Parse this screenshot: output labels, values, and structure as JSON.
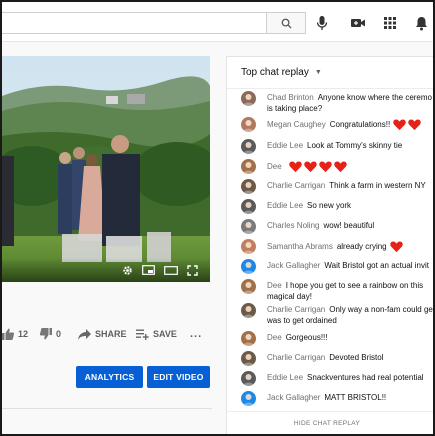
{
  "actions": {
    "likes": "12",
    "dislikes": "0",
    "share_label": "SHARE",
    "save_label": "SAVE",
    "more_label": "..."
  },
  "buttons": {
    "analytics": "ANALYTICS",
    "edit_video": "EDIT VIDEO"
  },
  "chat": {
    "header": "Top chat replay",
    "hide_label": "HIDE CHAT REPLAY",
    "messages": [
      {
        "author": "Chad Brinton",
        "text": "Anyone know where the ceremo",
        "text2": "is taking place?"
      },
      {
        "author": "Megan Caughey",
        "text": "Congratulations!!",
        "hearts": 2
      },
      {
        "author": "Eddie Lee",
        "text": "Look at Tommy's skinny tie"
      },
      {
        "author": "Dee",
        "text": "",
        "hearts": 4
      },
      {
        "author": "Charlie Carrigan",
        "text": "Think a farm in western NY"
      },
      {
        "author": "Eddie Lee",
        "text": "So new york"
      },
      {
        "author": "Charles Noling",
        "text": "wow! beautiful"
      },
      {
        "author": "Samantha Abrams",
        "text": "already crying",
        "hearts": 1
      },
      {
        "author": "Jack Gallagher",
        "text": "Wait Bristol got an actual invit"
      },
      {
        "author": "Dee",
        "text": "I hope you get to see a rainbow on this",
        "text2": "magical day!"
      },
      {
        "author": "Charlie Carrigan",
        "text": "Only way a non-fam could ge",
        "text2": "was to get ordained"
      },
      {
        "author": "Dee",
        "text": "Gorgeous!!!"
      },
      {
        "author": "Charlie Carrigan",
        "text": "Devoted Bristol"
      },
      {
        "author": "Eddie Lee",
        "text": "Snackventures had real potential"
      },
      {
        "author": "Jack Gallagher",
        "text": "MATT BRISTOL!!"
      }
    ]
  },
  "colors": {
    "accent": "#065fd4",
    "heart": "#e62117"
  }
}
